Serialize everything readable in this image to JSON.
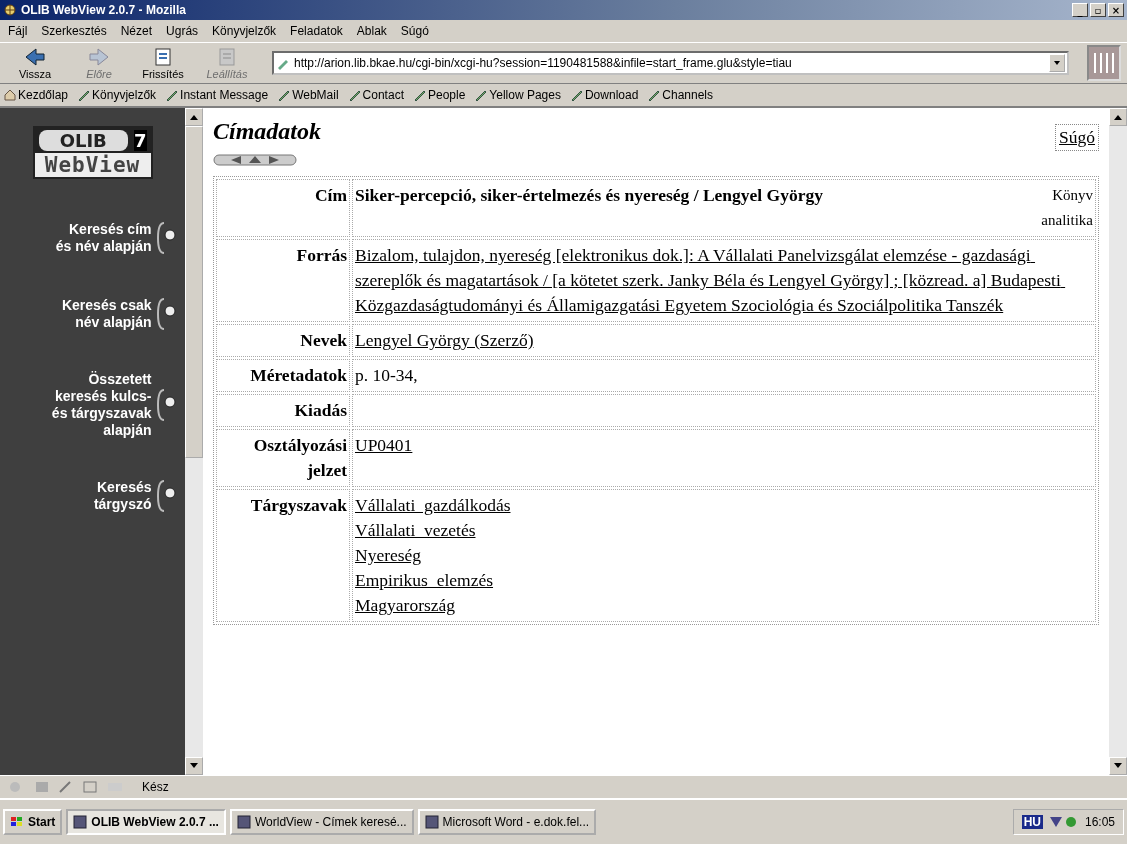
{
  "window": {
    "title": "OLIB WebView 2.0.7 - Mozilla",
    "controls": [
      "_",
      "▫",
      "×"
    ]
  },
  "menubar": [
    "Fájl",
    "Szerkesztés",
    "Nézet",
    "Ugrás",
    "Könyvjelzők",
    "Feladatok",
    "Ablak",
    "Súgó"
  ],
  "navbar": {
    "buttons": [
      {
        "label": "Vissza",
        "disabled": false
      },
      {
        "label": "Előre",
        "disabled": true
      },
      {
        "label": "Frissítés",
        "disabled": false
      },
      {
        "label": "Leállítás",
        "disabled": true
      }
    ],
    "address": "http://arion.lib.bkae.hu/cgi-bin/xcgi-hu?session=1190481588&infile=start_frame.glu&style=tiau"
  },
  "personal_toolbar": [
    "Kezdőlap",
    "Könyvjelzők",
    "Instant Message",
    "WebMail",
    "Contact",
    "People",
    "Yellow Pages",
    "Download",
    "Channels"
  ],
  "sidebar": {
    "logo": {
      "top": "OLIB",
      "badge": "7",
      "bottom": "WebView"
    },
    "items": [
      {
        "label": "Keresés cím és név alapján"
      },
      {
        "label": "Keresés csak név alapján"
      },
      {
        "label": "Összetett keresés kulcs- és tárgyszavak alapján"
      },
      {
        "label": "Keresés tárgyszó"
      }
    ]
  },
  "record": {
    "title": "Címadatok",
    "help": "Súgó",
    "rows": [
      {
        "label": "Cím",
        "kind": "title",
        "value": "Siker-percepció, siker-értelmezés és nyereség / Lengyel György",
        "type": "Könyv analitika"
      },
      {
        "label": "Forrás",
        "kind": "links",
        "values": [
          "Bizalom, tulajdon, nyereség [elektronikus dok.]: A Vállalati Panelvizsgálat elemzése - gazdasági szereplők és magatartások / [a kötetet szerk. Janky Béla és Lengyel György] ; [közread. a] Budapesti Közgazdaságtudományi és Államigazgatási Egyetem Szociológia és Szociálpolitika Tanszék"
        ]
      },
      {
        "label": "Nevek",
        "kind": "links",
        "values": [
          "Lengyel György (Szerző)"
        ]
      },
      {
        "label": "Méretadatok",
        "kind": "text",
        "value": "p. 10-34,"
      },
      {
        "label": "Kiadás",
        "kind": "text"
      },
      {
        "label": "Osztályozási jelzet",
        "kind": "links",
        "values": [
          "UP0401"
        ]
      },
      {
        "label": "Tárgyszavak",
        "kind": "links",
        "values": [
          "Vállalati  gazdálkodás",
          "Vállalati  vezetés",
          "Nyereség",
          "Empirikus  elemzés",
          "Magyarország"
        ]
      }
    ]
  },
  "status_bar": {
    "text": "Kész"
  },
  "taskbar": {
    "start": "Start",
    "items": [
      {
        "label": "OLIB WebView 2.0.7 ...",
        "selected": true
      },
      {
        "label": "WorldView - Címek keresé...",
        "selected": false
      },
      {
        "label": "Microsoft Word - e.dok.fel...",
        "selected": false
      }
    ],
    "language": "HU",
    "clock": "16:05"
  }
}
